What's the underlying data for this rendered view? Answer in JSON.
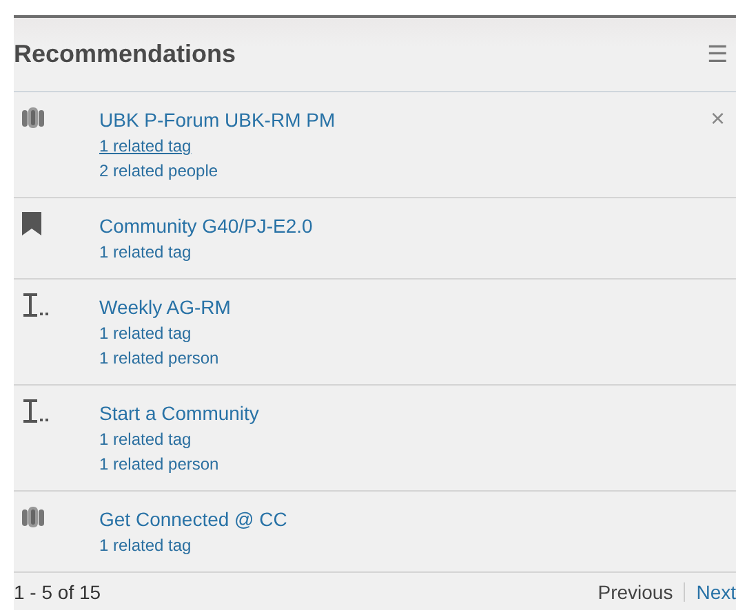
{
  "panel": {
    "title": "Recommendations",
    "menu_icon": "☰"
  },
  "items": [
    {
      "kind": "group",
      "title": "UBK P-Forum UBK-RM PM",
      "hovered": true,
      "close": "×",
      "details": [
        "1 related tag",
        "2 related people"
      ]
    },
    {
      "kind": "bookmark",
      "title": "Community G40/PJ-E2.0",
      "hovered": false,
      "details": [
        "1 related tag"
      ]
    },
    {
      "kind": "cursor",
      "title": "Weekly AG-RM",
      "hovered": false,
      "details": [
        "1 related tag",
        "1 related person"
      ]
    },
    {
      "kind": "cursor",
      "title": "Start a Community",
      "hovered": false,
      "details": [
        "1 related tag",
        "1 related person"
      ]
    },
    {
      "kind": "group",
      "title": "Get Connected @ CC",
      "hovered": false,
      "details": [
        "1 related tag"
      ]
    }
  ],
  "footer": {
    "range": "1 - 5 of 15",
    "previous": {
      "label": "Previous",
      "disabled": true
    },
    "next": {
      "label": "Next",
      "disabled": false
    }
  }
}
